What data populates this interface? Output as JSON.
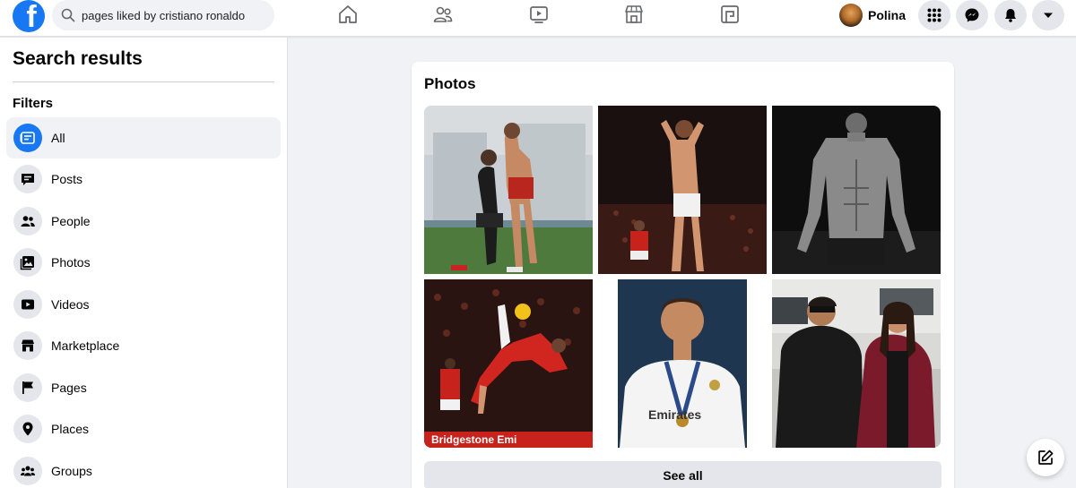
{
  "header": {
    "logo": "f",
    "search": {
      "value": "pages liked by cristiano ronaldo",
      "icon": "search-icon"
    },
    "nav_icons": [
      "home-icon",
      "friends-icon",
      "watch-icon",
      "marketplace-icon",
      "gaming-icon"
    ],
    "profile_name": "Polina",
    "action_icons": [
      "menu-grid-icon",
      "messenger-icon",
      "notifications-icon",
      "account-chevron-icon"
    ]
  },
  "sidebar": {
    "title": "Search results",
    "filters_label": "Filters",
    "items": [
      {
        "label": "All",
        "icon": "all-icon",
        "active": true
      },
      {
        "label": "Posts",
        "icon": "posts-icon"
      },
      {
        "label": "People",
        "icon": "people-icon"
      },
      {
        "label": "Photos",
        "icon": "photos-icon"
      },
      {
        "label": "Videos",
        "icon": "videos-icon"
      },
      {
        "label": "Marketplace",
        "icon": "marketplace-icon"
      },
      {
        "label": "Pages",
        "icon": "pages-flag-icon"
      },
      {
        "label": "Places",
        "icon": "places-pin-icon"
      },
      {
        "label": "Groups",
        "icon": "groups-icon"
      }
    ]
  },
  "photos": {
    "title": "Photos",
    "see_all": "See all",
    "items": [
      "photo-players-embrace",
      "photo-celebration-red-kit",
      "photo-shirtless-bw",
      "photo-bicycle-kick",
      "photo-white-kit-medal",
      "photo-couple-street"
    ],
    "jersey_text": "Emirates",
    "banner_text": "Bridgestone  Emi"
  },
  "colors": {
    "brand": "#1877f2",
    "background": "#f0f2f5"
  }
}
